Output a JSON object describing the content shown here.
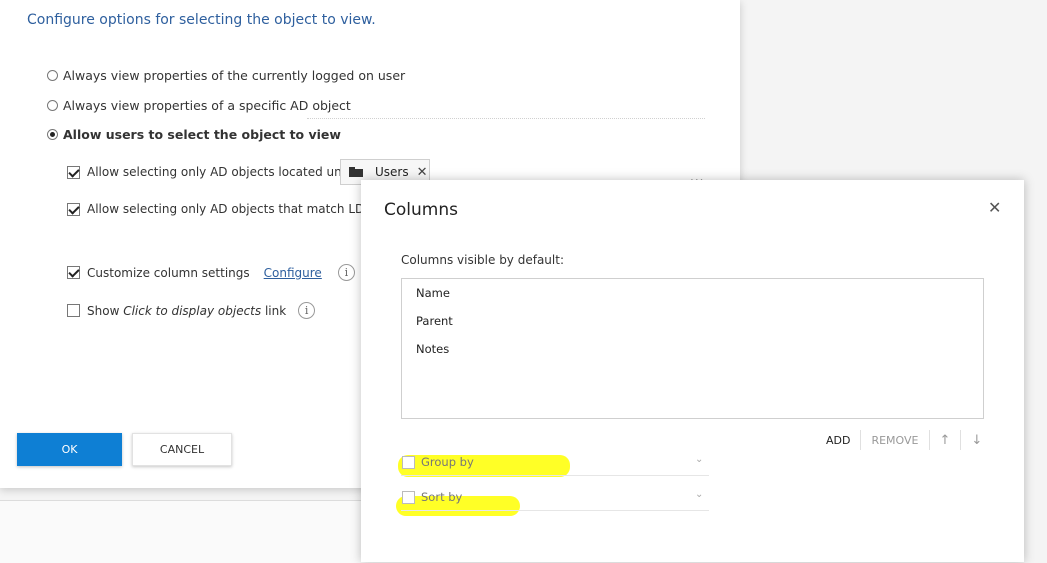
{
  "main_dialog": {
    "heading": "Configure options for selecting the object to view.",
    "radios": [
      {
        "label": "Always view properties of the currently logged on user",
        "checked": false
      },
      {
        "label": "Always view properties of a specific AD object",
        "checked": false
      },
      {
        "label": "Allow users to select the object to view",
        "checked": true
      }
    ],
    "options": {
      "located_under": {
        "label": "Allow selecting only AD objects located under",
        "checked": true,
        "chip": "Users"
      },
      "ldap_filter": {
        "label": "Allow selecting only AD objects that match LDAP filt",
        "checked": true
      },
      "customize_columns": {
        "label": "Customize column settings",
        "checked": true,
        "link": "Configure"
      },
      "show_link": {
        "label_pre": "Show ",
        "label_em": "Click to display objects",
        "label_post": " link",
        "checked": false
      }
    },
    "more": "...",
    "ok_label": "OK",
    "cancel_label": "CANCEL"
  },
  "columns_dialog": {
    "title": "Columns",
    "close": "✕",
    "subtitle": "Columns visible by default:",
    "columns": [
      "Name",
      "Parent",
      "Notes"
    ],
    "toolbar": {
      "add": "ADD",
      "remove": "REMOVE",
      "up": "↑",
      "down": "↓"
    },
    "group_by": {
      "label": "Group by",
      "checked": false
    },
    "sort_by": {
      "label": "Sort by",
      "checked": false
    }
  },
  "colors": {
    "accent": "#0e7fd4",
    "heading": "#2e5f9e",
    "highlight": "#ffff00"
  }
}
